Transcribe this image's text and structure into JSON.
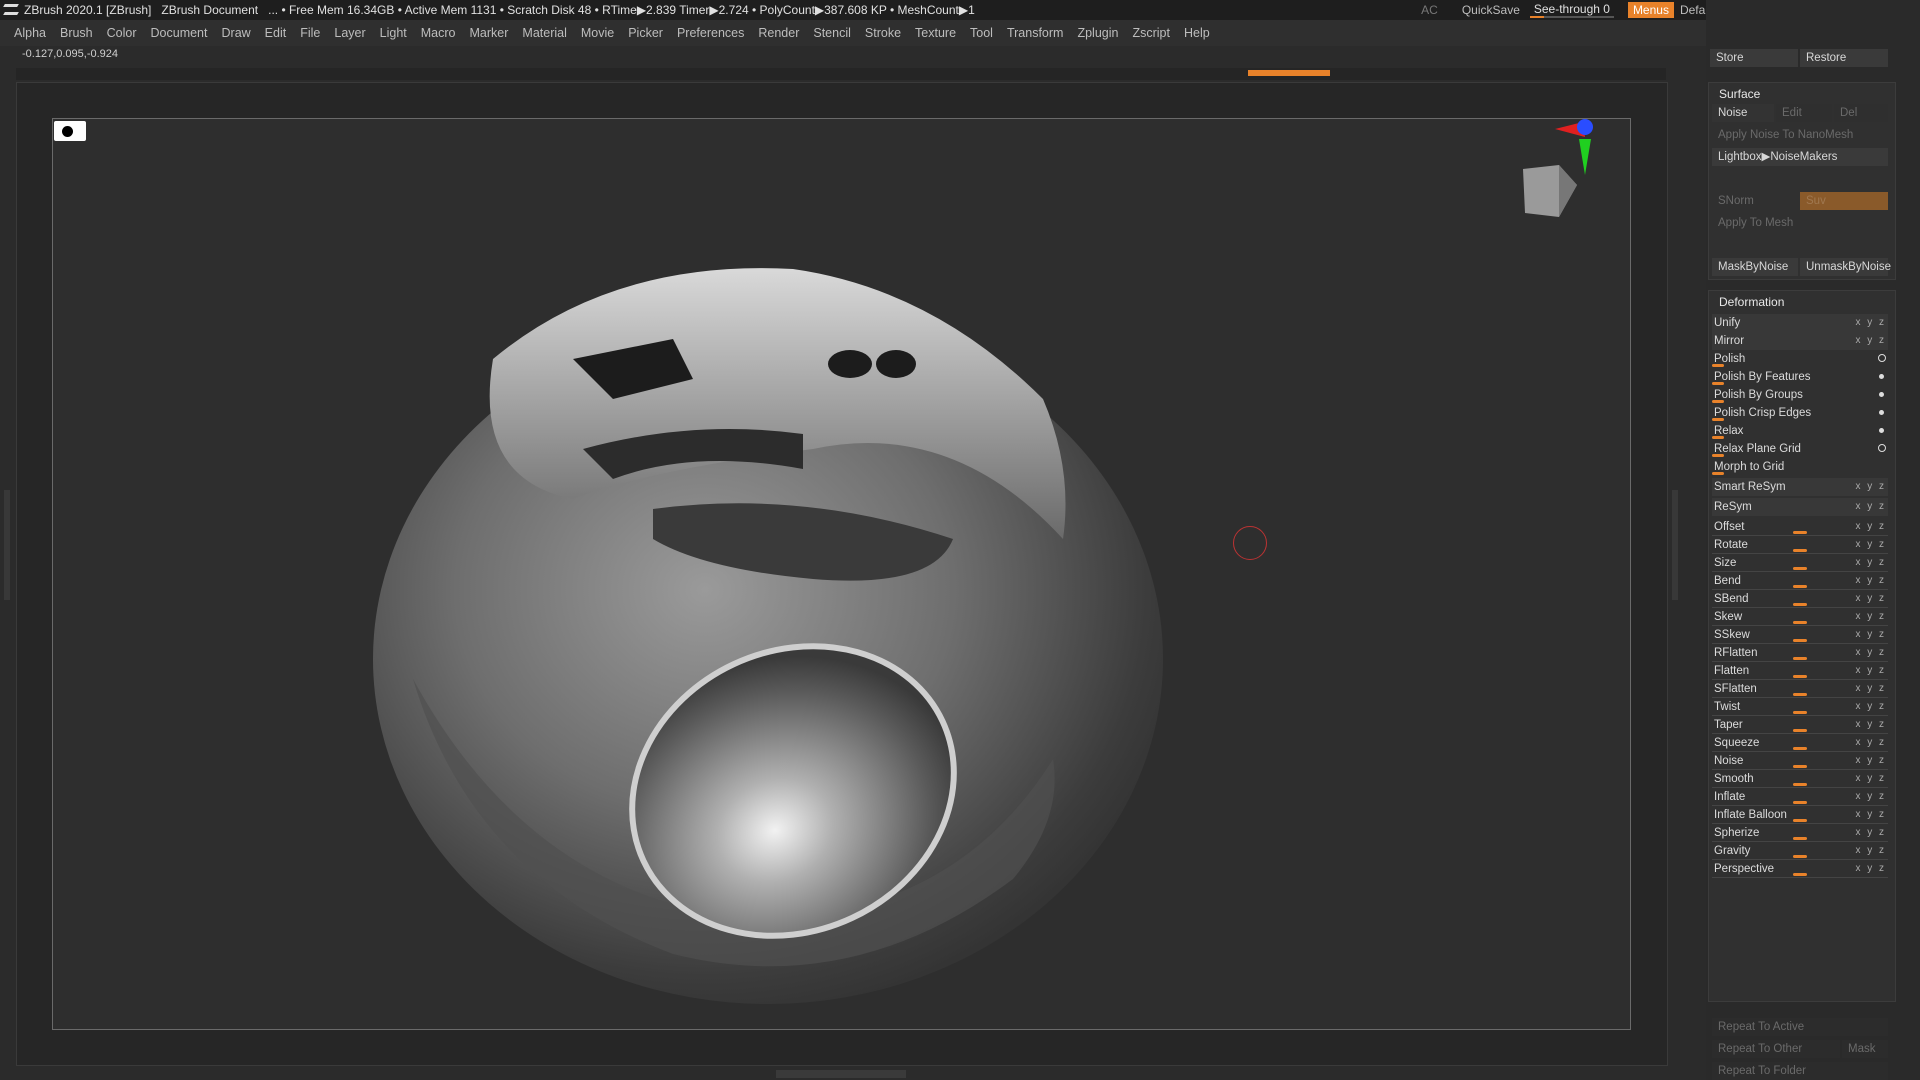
{
  "titlebar": {
    "app": "ZBrush 2020.1 [ZBrush]",
    "document": "ZBrush Document",
    "stats": "... • Free Mem 16.34GB • Active Mem 1131 • Scratch Disk 48 • RTime▶2.839 Timer▶2.724 • PolyCount▶387.608 KP • MeshCount▶1",
    "ac": "AC",
    "quicksave": "QuickSave",
    "seethrough": "See-through  0",
    "menus": "Menus",
    "script": "DefaultZScript"
  },
  "menu": [
    "Alpha",
    "Brush",
    "Color",
    "Document",
    "Draw",
    "Edit",
    "File",
    "Layer",
    "Light",
    "Macro",
    "Marker",
    "Material",
    "Movie",
    "Picker",
    "Preferences",
    "Render",
    "Stencil",
    "Stroke",
    "Texture",
    "Tool",
    "Transform",
    "Zplugin",
    "Zscript",
    "Help"
  ],
  "coords": "-0.127,0.095,-0.924",
  "panel": {
    "store": "Store",
    "restore": "Restore",
    "surface": {
      "title": "Surface",
      "noise": "Noise",
      "edit": "Edit",
      "del": "Del",
      "apply_nano": "Apply Noise To NanoMesh",
      "lightbox": "Lightbox▶NoiseMakers",
      "snorm": "SNorm",
      "suv": "Suv",
      "apply_mesh": "Apply To Mesh",
      "mask_by_noise": "MaskByNoise",
      "unmask_by_noise": "UnmaskByNoise"
    },
    "deformation": {
      "title": "Deformation",
      "rows": [
        "Unify",
        "Mirror",
        "Polish",
        "Polish By Features",
        "Polish By Groups",
        "Polish Crisp Edges",
        "Relax",
        "Relax Plane Grid",
        "Morph to Grid",
        "Smart ReSym",
        "ReSym",
        "Offset",
        "Rotate",
        "Size",
        "Bend",
        "SBend",
        "Skew",
        "SSkew",
        "RFlatten",
        "Flatten",
        "SFlatten",
        "Twist",
        "Taper",
        "Squeeze",
        "Noise",
        "Smooth",
        "Inflate",
        "Inflate Balloon",
        "Spherize",
        "Gravity",
        "Perspective"
      ],
      "xyz": "x y z"
    },
    "repeat_active": "Repeat To Active",
    "repeat_other": "Repeat To Other",
    "mask": "Mask",
    "repeat_folder": "Repeat To Folder"
  }
}
